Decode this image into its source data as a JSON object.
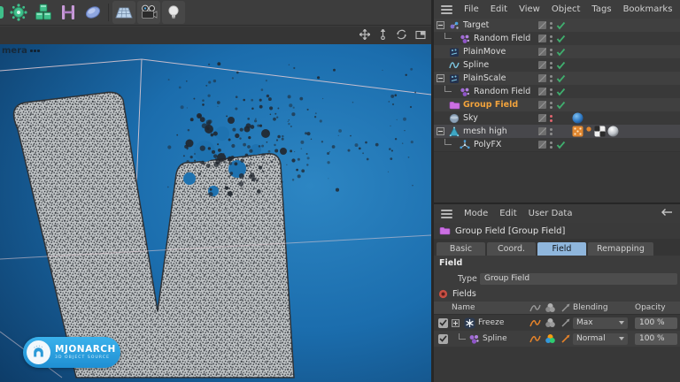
{
  "toolbar": {
    "icons": [
      "clipped-green-icon",
      "mograph-gear-icon",
      "cloner-cubes-icon",
      "mospline-icon",
      "disc-icon",
      "floor-icon",
      "camera-icon",
      "light-icon"
    ]
  },
  "viewport": {
    "camera_label": "mera",
    "nav_icons": [
      "pan-icon",
      "dolly-icon",
      "orbit-icon",
      "maximize-view-icon"
    ],
    "watermark": {
      "title": "MJONARCH",
      "subtitle": "3D OBJECT SOURCE"
    }
  },
  "object_manager": {
    "menu": [
      "File",
      "Edit",
      "View",
      "Object",
      "Tags",
      "Bookmarks"
    ],
    "items": [
      {
        "label": "Target"
      },
      {
        "label": "Random Field"
      },
      {
        "label": "PlainMove"
      },
      {
        "label": "Spline"
      },
      {
        "label": "PlainScale"
      },
      {
        "label": "Random Field"
      },
      {
        "label": "Group Field"
      },
      {
        "label": "Sky"
      },
      {
        "label": "mesh high"
      },
      {
        "label": "PolyFX"
      }
    ]
  },
  "attribute_manager": {
    "menu": [
      "Mode",
      "Edit",
      "User Data"
    ],
    "object_title": "Group Field [Group Field]",
    "tabs": [
      "Basic",
      "Coord.",
      "Field",
      "Remapping"
    ],
    "selected_tab": "Field",
    "section_label": "Field",
    "type_label": "Type",
    "type_value": "Group Field",
    "fields_label": "Fields",
    "table": {
      "columns": [
        "Name",
        "Blending",
        "Opacity"
      ],
      "rows": [
        {
          "name": "Freeze",
          "blending": "Max",
          "opacity": "100 %"
        },
        {
          "name": "Spline",
          "blending": "Normal",
          "opacity": "100 %"
        }
      ]
    }
  },
  "colors": {
    "selected_object_text": "#f2a33c",
    "selected_tab_bg": "#8fb6dc",
    "enabled_check_green": "#3fae6e",
    "viewport_blue": "#1b6dad",
    "watermark_blue": "#2aa2e0",
    "field_wave_orange": "#e6832a"
  }
}
